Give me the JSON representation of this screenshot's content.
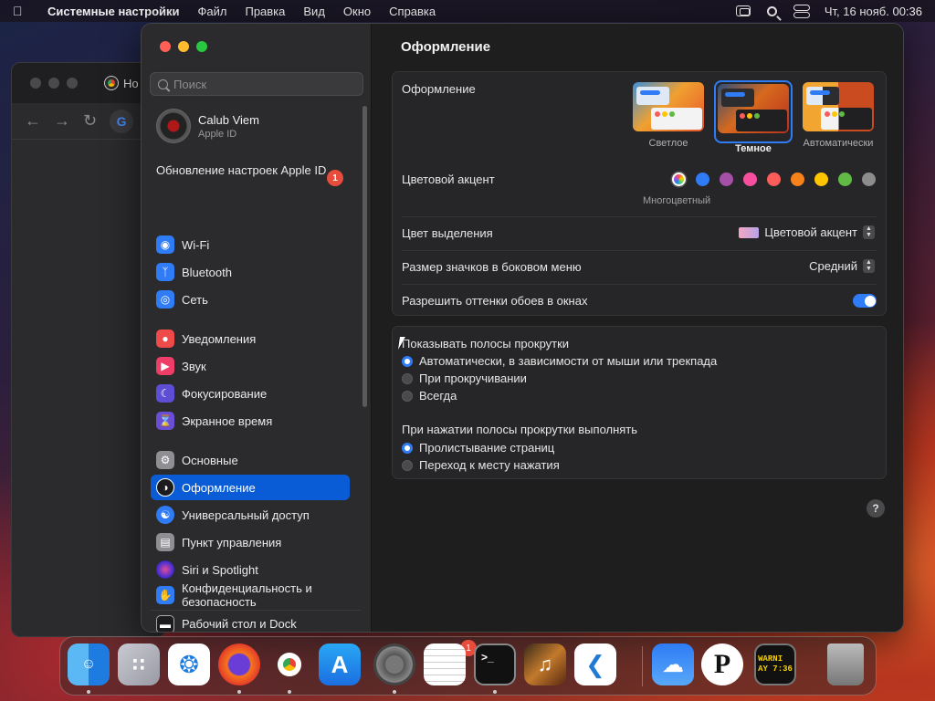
{
  "menubar": {
    "app_name": "Системные настройки",
    "items": [
      "Файл",
      "Правка",
      "Вид",
      "Окно",
      "Справка"
    ],
    "clock": "Чт, 16 нояб.  00:36"
  },
  "chrome": {
    "tab_label": "Но"
  },
  "sidebar": {
    "search_placeholder": "Поиск",
    "profile_name": "Calub Viem",
    "profile_sub": "Apple ID",
    "update_label": "Обновление настроек Apple ID",
    "update_badge": "1",
    "items": [
      {
        "label": "Wi-Fi",
        "icon": "wifi-icon",
        "color": "#2f7cf6"
      },
      {
        "label": "Bluetooth",
        "icon": "bluetooth-icon",
        "color": "#2f7cf6"
      },
      {
        "label": "Сеть",
        "icon": "globe-icon",
        "color": "#2f7cf6"
      },
      {
        "label": "Уведомления",
        "icon": "bell-icon",
        "color": "#ee4a4a"
      },
      {
        "label": "Звук",
        "icon": "speaker-icon",
        "color": "#ee3e68"
      },
      {
        "label": "Фокусирование",
        "icon": "moon-icon",
        "color": "#5e4ed6"
      },
      {
        "label": "Экранное время",
        "icon": "hourglass-icon",
        "color": "#6a4fd6"
      },
      {
        "label": "Основные",
        "icon": "gear-icon",
        "color": "#8e8e93"
      },
      {
        "label": "Оформление",
        "icon": "appearance-icon",
        "color": "#1c1c1e"
      },
      {
        "label": "Универсальный доступ",
        "icon": "accessibility-icon",
        "color": "#2f7cf6"
      },
      {
        "label": "Пункт управления",
        "icon": "control-center-icon",
        "color": "#8e8e93"
      },
      {
        "label": "Siri и Spotlight",
        "icon": "siri-icon",
        "color": "#6b3fa0"
      },
      {
        "label": "Конфиденциальность и безопасность",
        "icon": "hand-icon",
        "color": "#2f7cf6"
      },
      {
        "label": "Рабочий стол и Dock",
        "icon": "dock-icon",
        "color": "#1c1c1e"
      }
    ]
  },
  "content": {
    "title": "Оформление",
    "appearance_label": "Оформление",
    "themes": [
      "Светлое",
      "Темное",
      "Автоматически"
    ],
    "selected_theme": "Темное",
    "accent_label": "Цветовой акцент",
    "accent_caption": "Многоцветный",
    "accent_colors": [
      "#2f7cf6",
      "#a550a7",
      "#f74f9e",
      "#fc5d5b",
      "#f7821b",
      "#ffc600",
      "#62ba46",
      "#8c8c8c"
    ],
    "highlight_label": "Цвет выделения",
    "highlight_value": "Цветовой акцент",
    "icon_size_label": "Размер значков в боковом меню",
    "icon_size_value": "Средний",
    "tint_label": "Разрешить оттенки обоев в окнах",
    "tint_on": true,
    "scrollbars_label": "Показывать полосы прокрутки",
    "scrollbar_options": [
      "Автоматически, в зависимости от мыши или трекпада",
      "При прокручивании",
      "Всегда"
    ],
    "click_label": "При нажатии полосы прокрутки выполнять",
    "click_options": [
      "Пролистывание страниц",
      "Переход к месту нажатия"
    ],
    "help": "?"
  },
  "dock": {
    "settings_badge": "1",
    "warning_text": "WARNI\nAY 7:36",
    "p_letter": "P"
  }
}
